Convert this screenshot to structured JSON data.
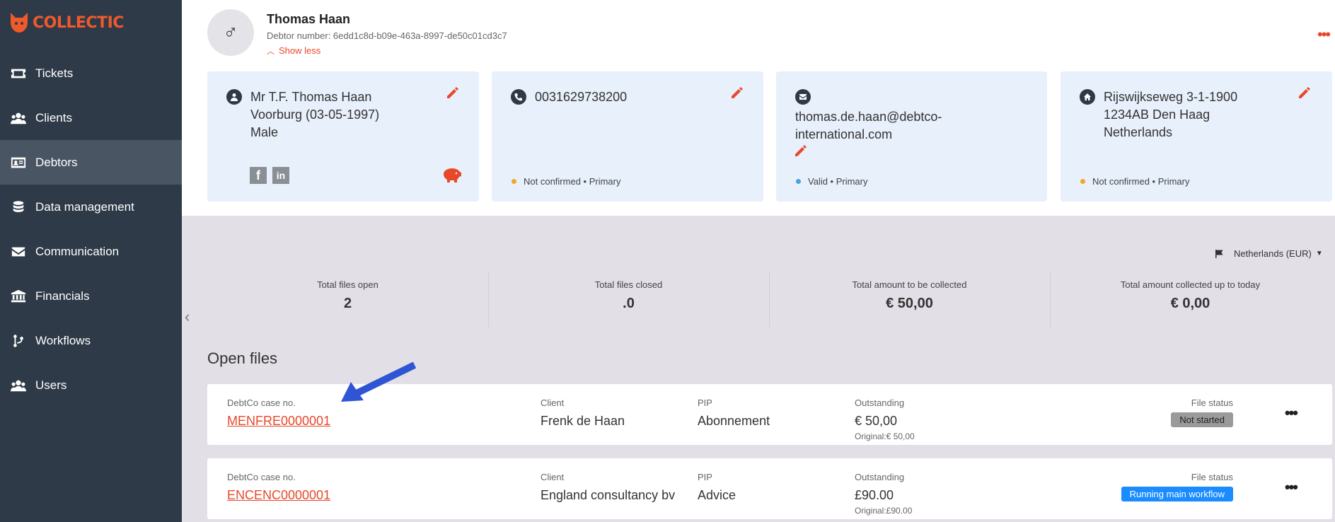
{
  "app": {
    "logo_text": "COLLECTIC"
  },
  "sidebar": {
    "items": [
      {
        "label": "Tickets",
        "icon": "ticket-icon"
      },
      {
        "label": "Clients",
        "icon": "users-icon"
      },
      {
        "label": "Debtors",
        "icon": "id-card-icon",
        "active": true
      },
      {
        "label": "Data management",
        "icon": "database-icon"
      },
      {
        "label": "Communication",
        "icon": "envelope-icon"
      },
      {
        "label": "Financials",
        "icon": "bank-icon"
      },
      {
        "label": "Workflows",
        "icon": "branch-icon"
      },
      {
        "label": "Users",
        "icon": "users-icon"
      }
    ]
  },
  "debtor": {
    "name": "Thomas Haan",
    "number": "Debtor number: 6edd1c8d-b09e-463a-8997-de50c01cd3c7",
    "show_less": "Show less"
  },
  "cards": {
    "person": {
      "line1": "Mr T.F. Thomas Haan",
      "line2": "Voorburg (03-05-1997)",
      "line3": "Male"
    },
    "phone": {
      "number": "0031629738200",
      "status": "Not confirmed • Primary"
    },
    "email": {
      "line1": "thomas.de.haan@debtco-",
      "line2": "international.com",
      "status": "Valid • Primary"
    },
    "address": {
      "line1": "Rijswijkseweg 3-1-1900",
      "line2": "1234AB Den Haag",
      "line3": "Netherlands",
      "status": "Not confirmed • Primary"
    }
  },
  "region": {
    "label": "Netherlands (EUR)"
  },
  "summary": [
    {
      "label": "Total files open",
      "value": "2"
    },
    {
      "label": "Total files closed",
      "value": ".0"
    },
    {
      "label": "Total amount to be collected",
      "value": "€ 50,00"
    },
    {
      "label": "Total amount collected up to today",
      "value": "€ 0,00"
    }
  ],
  "open_files": {
    "title": "Open files",
    "headers": {
      "case": "DebtCo case no.",
      "client": "Client",
      "pip": "PIP",
      "outstanding": "Outstanding",
      "status": "File status"
    },
    "rows": [
      {
        "case": "MENFRE0000001",
        "client": "Frenk de Haan",
        "pip": "Abonnement",
        "outstanding": "€ 50,00",
        "original": "Original:€ 50,00",
        "status": "Not started"
      },
      {
        "case": "ENCENC0000001",
        "client": "England consultancy bv",
        "pip": "Advice",
        "outstanding": "£90.00",
        "original": "Original:£90.00",
        "status": "Running main workflow"
      }
    ]
  },
  "colors": {
    "accent": "#e8482a",
    "sidebar": "#2e3a48",
    "sidebar_active": "#4a5563",
    "card_bg": "#e8f0fb",
    "status_orange": "#f5a623",
    "status_blue": "#4aa3df",
    "badge_grey": "#8a8a8a",
    "badge_blue": "#1a8cff"
  }
}
